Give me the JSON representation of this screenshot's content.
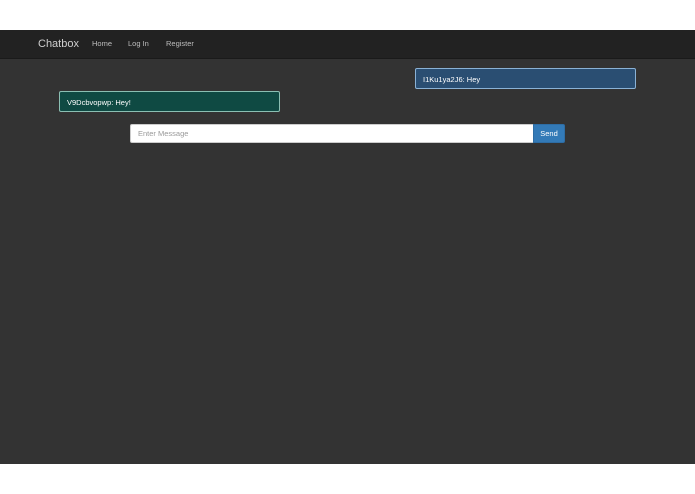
{
  "navbar": {
    "brand": "Chatbox",
    "links": [
      {
        "label": "Home"
      },
      {
        "label": "Log In"
      },
      {
        "label": "Register"
      }
    ]
  },
  "messages": [
    {
      "author": "I1Ku1ya2J6",
      "text": "Hey",
      "display": "I1Ku1ya2J6: Hey",
      "side": "right",
      "color": "#2a4e72"
    },
    {
      "author": "V9Dcbvopwp",
      "text": "Hey!",
      "display": "V9Dcbvopwp: Hey!",
      "side": "left",
      "color": "#0f4a43"
    }
  ],
  "composer": {
    "value": "",
    "placeholder": "Enter Message",
    "send_label": "Send"
  },
  "colors": {
    "page_background": "#333333",
    "navbar_background": "#222222",
    "send_button": "#337ab7"
  }
}
